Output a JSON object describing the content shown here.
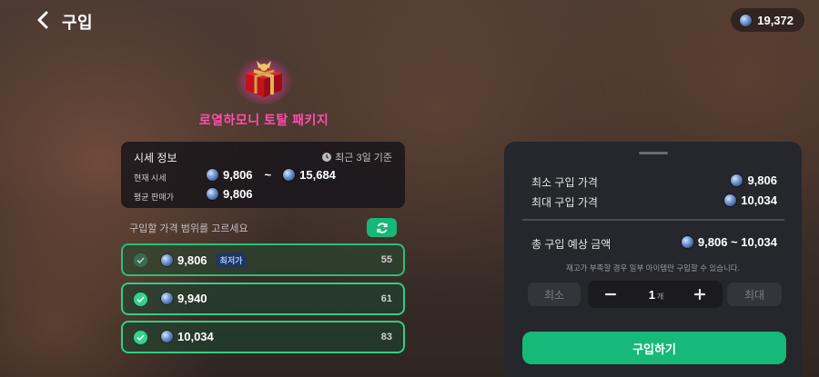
{
  "header": {
    "title": "구입",
    "balance": "19,372"
  },
  "item": {
    "name": "로열하모니 토탈 패키지"
  },
  "price_info": {
    "title": "시세 정보",
    "period": "최근 3일 기준",
    "current_label": "현재 시세",
    "current_min": "9,806",
    "range_sep": "~",
    "current_max": "15,684",
    "average_label": "평균 판매가",
    "average_value": "9,806"
  },
  "choose_label": "구입할 가격 범위를 고르세요",
  "options": [
    {
      "price": "9,806",
      "badge": "최저가",
      "count": "55",
      "checked": true
    },
    {
      "price": "9,940",
      "badge": "",
      "count": "61",
      "checked": true
    },
    {
      "price": "10,034",
      "badge": "",
      "count": "83",
      "checked": true
    }
  ],
  "panel": {
    "min_label": "최소 구입 가격",
    "min_value": "9,806",
    "max_label": "최대 구입 가격",
    "max_value": "10,034",
    "total_label": "총 구입 예상 금액",
    "total_value": "9,806 ~ 10,034",
    "notice": "재고가 부족할 경우 일부 아이템만 구입할 수 있습니다.",
    "min_btn": "최소",
    "quantity": "1",
    "quantity_unit": "개",
    "max_btn": "최대",
    "buy_btn": "구입하기"
  },
  "colors": {
    "accent_green": "#16b977",
    "item_pink": "#ff4fae",
    "panel_bg": "#26262d"
  },
  "icons": {
    "back": "chevron-left-icon",
    "coin": "coin-icon",
    "clock": "clock-icon",
    "refresh": "refresh-icon",
    "check": "check-icon",
    "minus": "minus-icon",
    "plus": "plus-icon"
  }
}
